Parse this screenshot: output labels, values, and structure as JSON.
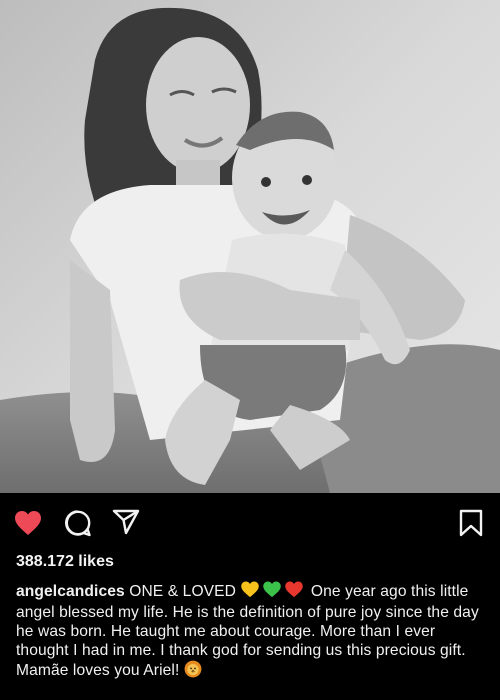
{
  "post": {
    "likes": "388.172 likes",
    "username": "angelcandices",
    "caption_lead": " ONE & LOVED ",
    "caption_body": " One year ago this little angel blessed my life. He is the definition of pure joy since the day he was born. He taught me about courage. More than I ever thought I had in me. I thank god for sending us this precious gift. Mamãe loves you Ariel! ",
    "caption_hearts": [
      "yellow-heart",
      "green-heart",
      "red-heart"
    ],
    "caption_end_emoji": "lion-face-icon"
  },
  "actions": {
    "like": "heart-icon",
    "comment": "comment-icon",
    "share": "share-icon",
    "save": "bookmark-icon"
  },
  "colors": {
    "like_red": "#ed4956",
    "yellow_heart": "#f7c21b",
    "green_heart": "#3cc24a",
    "red_heart": "#e7372f",
    "background": "#000000"
  }
}
